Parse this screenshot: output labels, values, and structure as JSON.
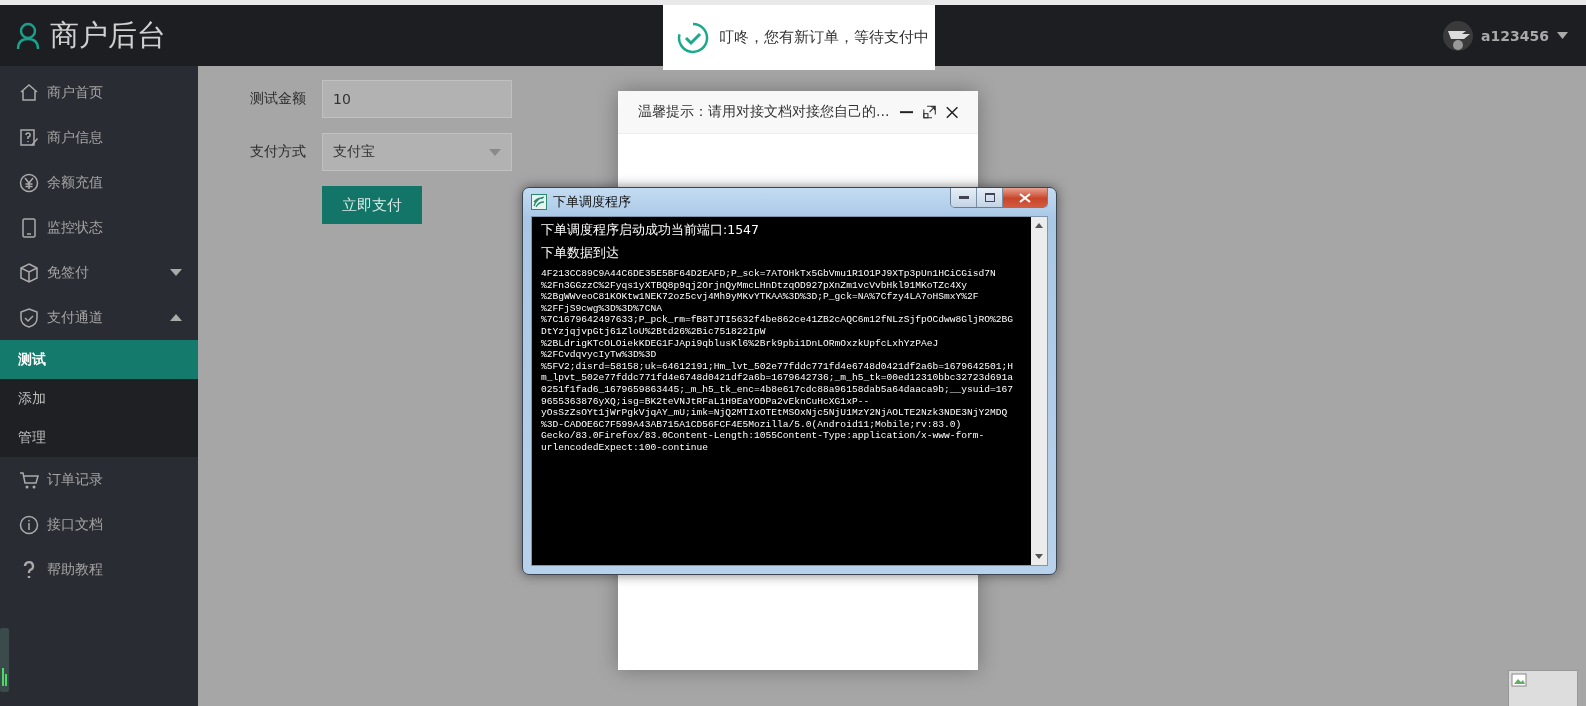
{
  "header": {
    "logo_text": "商户后台",
    "user": {
      "name": "a123456"
    }
  },
  "sidebar": {
    "items": [
      {
        "label": "商户首页",
        "kind": "link"
      },
      {
        "label": "商户信息",
        "kind": "link"
      },
      {
        "label": "余额充值",
        "kind": "link"
      },
      {
        "label": "监控状态",
        "kind": "link"
      },
      {
        "label": "免签付",
        "kind": "group",
        "expanded": false
      },
      {
        "label": "支付通道",
        "kind": "group",
        "expanded": true,
        "children": [
          {
            "label": "测试",
            "selected": true
          },
          {
            "label": "添加",
            "selected": false
          },
          {
            "label": "管理",
            "selected": false
          }
        ]
      },
      {
        "label": "订单记录",
        "kind": "link"
      },
      {
        "label": "接口文档",
        "kind": "link"
      },
      {
        "label": "帮助教程",
        "kind": "link"
      }
    ]
  },
  "form": {
    "fields": [
      {
        "label": "测试金额",
        "value": "10",
        "kind": "input"
      },
      {
        "label": "支付方式",
        "value": "支付宝",
        "kind": "select"
      }
    ],
    "submit": "立即支付"
  },
  "toast": {
    "text": "叮咚，您有新订单，等待支付中"
  },
  "dialog": {
    "title": "温馨提示：请用对接文档对接您自己的…"
  },
  "console_window": {
    "title": "下单调度程序",
    "messages": [
      "下单调度程序启动成功当前端口:1547",
      "下单数据到达"
    ],
    "lines": [
      "4F213CC89C9A44C6DE35E5BF64D2EAFD;P_sck=7ATOHkTx5GbVmu1R1O1PJ9XTp3pUn1HCiCGisd7N",
      "%2Fn3GGzzC%2Fyqs1yXTBQ8p9qj2OrjnQyMmcLHnDtzqOD927pXnZm1vcVvbHkl91MKoTZc4Xy",
      "%2BgWWveoC81KOKtw1NEK72oz5cvj4Mh9yMKvYTKAA%3D%3D;P_gck=NA%7Cfzy4LA7oHSmxY%2F",
      "%2FFjS9cwg%3D%3D%7CNA",
      "%7C1679642497633;P_pck_rm=fB8TJTI5632f4be862ce41ZB2cAQC6m12fNLzSjfpOCdww8GljRO%2BG",
      "DtYzjqjvpGtj61ZloU%2Btd26%2Bic751822IpW",
      "%2BLdrigKTcOLOiekKDEG1FJApi9qblusKl6%2Brk9pbi1DnLORmOxzkUpfcLxhYzPAeJ",
      "%2FCvdqvycIyTw%3D%3D",
      "%5FV2;disrd=58158;uk=64612191;Hm_lvt_502e77fddc771fd4e6748d0421df2a6b=1679642501;H",
      "m_lpvt_502e77fddc771fd4e6748d0421df2a6b=1679642736;_m_h5_tk=00ed12310bbc32723d691a",
      "0251f1fad6_1679659863445;_m_h5_tk_enc=4b8e617cdc88a96158dab5a64daaca9b;__ysuid=167",
      "9655363876yXQ;isg=BK2teVNJtRFaL1H9EaYODPa2vEknCuHcXG1xP--",
      "yOsSzZsOYt1jWrPgkVjqAY_mU;imk=NjQ2MTIxOTEtMSOxNjc5NjU1MzY2NjAOLTE2Nzk3NDE3NjY2MDQ",
      "%3D-CADOE6C7F599A43AB715A1CD56FCF4E5Mozilla/5.0(Android11;Mobile;rv:83.0)",
      "Gecko/83.0Firefox/83.0Content-Length:1055Content-Type:application/x-www-form-",
      "urlencodedExpect:100-continue"
    ]
  }
}
